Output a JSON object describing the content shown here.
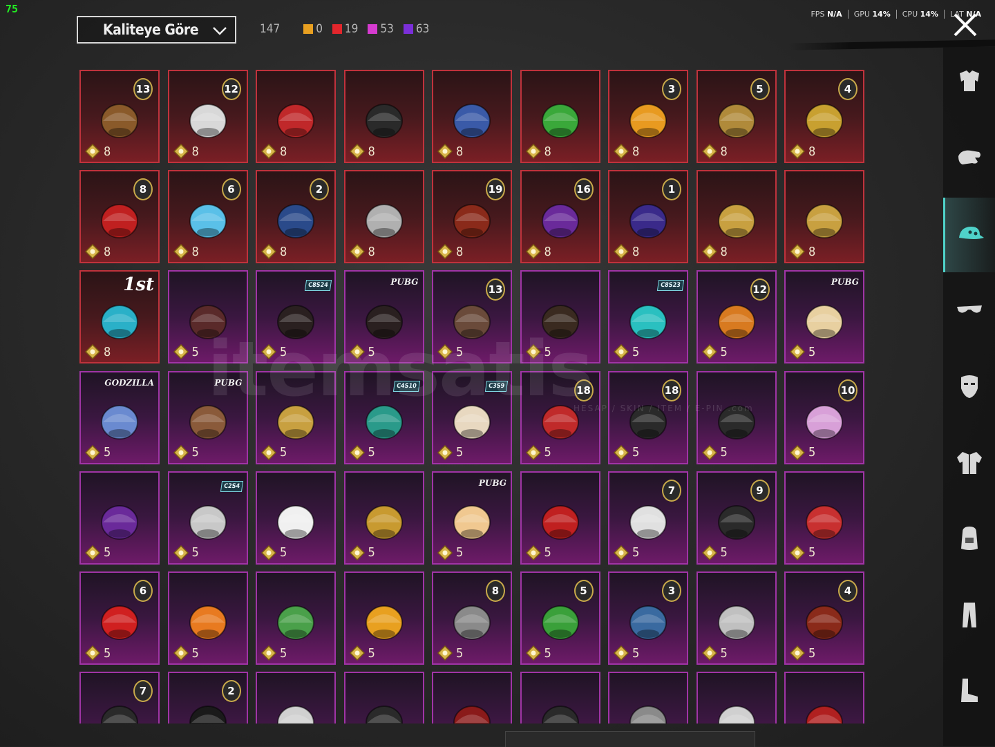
{
  "fps_counter": "75",
  "sort": {
    "label": "Kaliteye Göre"
  },
  "counts": {
    "total": "147",
    "items": [
      {
        "value": "0",
        "color": "#e8a021"
      },
      {
        "value": "19",
        "color": "#e3262c"
      },
      {
        "value": "53",
        "color": "#d63bd0"
      },
      {
        "value": "63",
        "color": "#7b2fd9"
      }
    ]
  },
  "stats": [
    {
      "label": "FPS",
      "value": "N/A"
    },
    {
      "label": "GPU",
      "value": "14%"
    },
    {
      "label": "CPU",
      "value": "14%"
    },
    {
      "label": "LAT",
      "value": "N/A"
    }
  ],
  "watermark": {
    "text": "itemsatis",
    "sub": "HESAP / SKIN / ITEM / E-PIN",
    "domain": ".com"
  },
  "colors": {
    "legendary_border": "#c0323c",
    "epic_border": "#a034a6",
    "accent": "#4fd2c9"
  },
  "sidebar": [
    {
      "name": "outfit-icon",
      "active": false
    },
    {
      "name": "glove-icon",
      "active": false
    },
    {
      "name": "cap-icon",
      "active": true
    },
    {
      "name": "glasses-icon",
      "active": false
    },
    {
      "name": "mask-icon",
      "active": false
    },
    {
      "name": "jacket-icon",
      "active": false
    },
    {
      "name": "backpack-icon",
      "active": false
    },
    {
      "name": "pants-icon",
      "active": false
    },
    {
      "name": "boots-icon",
      "active": false
    }
  ],
  "items": [
    {
      "q": "leg",
      "qty": "8",
      "badge": "13",
      "c": "#8a5a2a"
    },
    {
      "q": "leg",
      "qty": "8",
      "badge": "12",
      "c": "#d8d8d8"
    },
    {
      "q": "leg",
      "qty": "8",
      "badge": "",
      "c": "#c0282a"
    },
    {
      "q": "leg",
      "qty": "8",
      "badge": "",
      "c": "#2a2a2a"
    },
    {
      "q": "leg",
      "qty": "8",
      "badge": "",
      "c": "#3a5aa8"
    },
    {
      "q": "leg",
      "qty": "8",
      "badge": "",
      "c": "#3aa83a"
    },
    {
      "q": "leg",
      "qty": "8",
      "badge": "3",
      "c": "#e89a20"
    },
    {
      "q": "leg",
      "qty": "8",
      "badge": "5",
      "c": "#b08a3a"
    },
    {
      "q": "leg",
      "qty": "8",
      "badge": "4",
      "c": "#c8a030"
    },
    {
      "q": "leg",
      "qty": "8",
      "badge": "8",
      "c": "#c02020"
    },
    {
      "q": "leg",
      "qty": "8",
      "badge": "6",
      "c": "#5ac0e8"
    },
    {
      "q": "leg",
      "qty": "8",
      "badge": "2",
      "c": "#2a4a8a"
    },
    {
      "q": "leg",
      "qty": "8",
      "badge": "",
      "c": "#b0b0b0"
    },
    {
      "q": "leg",
      "qty": "8",
      "badge": "19",
      "c": "#8a2a1a"
    },
    {
      "q": "leg",
      "qty": "8",
      "badge": "16",
      "c": "#6a2a9a"
    },
    {
      "q": "leg",
      "qty": "8",
      "badge": "1",
      "c": "#3a2a8a"
    },
    {
      "q": "leg",
      "qty": "8",
      "badge": "",
      "c": "#c8a040"
    },
    {
      "q": "leg",
      "qty": "8",
      "badge": "",
      "c": "#c8a040"
    },
    {
      "q": "leg",
      "qty": "8",
      "tag": "1st",
      "c": "#2ab0c8"
    },
    {
      "q": "epic",
      "qty": "5",
      "badge": "",
      "c": "#5a2a2a"
    },
    {
      "q": "epic",
      "qty": "5",
      "season": "C8S24",
      "c": "#2a2020"
    },
    {
      "q": "epic",
      "qty": "5",
      "tag": "PUBG",
      "c": "#2a2020"
    },
    {
      "q": "epic",
      "qty": "5",
      "badge": "13",
      "c": "#6a4a3a"
    },
    {
      "q": "epic",
      "qty": "5",
      "badge": "",
      "c": "#3a2a20"
    },
    {
      "q": "epic",
      "qty": "5",
      "season": "C8S23",
      "c": "#2ac0c0"
    },
    {
      "q": "epic",
      "qty": "5",
      "badge": "12",
      "c": "#d87a20"
    },
    {
      "q": "epic",
      "qty": "5",
      "tag": "PUBG",
      "c": "#e8d0a0"
    },
    {
      "q": "epic",
      "qty": "5",
      "tag": "GODZILLA",
      "c": "#6a8ad0"
    },
    {
      "q": "epic",
      "qty": "5",
      "tag": "PUBG",
      "c": "#8a5a3a"
    },
    {
      "q": "epic",
      "qty": "5",
      "badge": "",
      "c": "#c8a040"
    },
    {
      "q": "epic",
      "qty": "5",
      "season": "C4S10",
      "c": "#2a9a8a"
    },
    {
      "q": "epic",
      "qty": "5",
      "season": "C3S9",
      "c": "#e8d8c0"
    },
    {
      "q": "epic",
      "qty": "5",
      "badge": "18",
      "c": "#c02a2a"
    },
    {
      "q": "epic",
      "qty": "5",
      "badge": "18",
      "c": "#2a2a2a"
    },
    {
      "q": "epic",
      "qty": "5",
      "badge": "",
      "c": "#2a2a2a"
    },
    {
      "q": "epic",
      "qty": "5",
      "badge": "10",
      "c": "#d8a0d8"
    },
    {
      "q": "epic",
      "qty": "5",
      "badge": "",
      "c": "#6a2a9a"
    },
    {
      "q": "epic",
      "qty": "5",
      "season": "C2S4",
      "c": "#c8c8c8"
    },
    {
      "q": "epic",
      "qty": "5",
      "badge": "",
      "c": "#f0f0f0"
    },
    {
      "q": "epic",
      "qty": "5",
      "badge": "",
      "c": "#c89a30"
    },
    {
      "q": "epic",
      "qty": "5",
      "tag": "PUBG",
      "c": "#f0c890"
    },
    {
      "q": "epic",
      "qty": "5",
      "badge": "",
      "c": "#c02020"
    },
    {
      "q": "epic",
      "qty": "5",
      "badge": "7",
      "c": "#e0e0e0"
    },
    {
      "q": "epic",
      "qty": "5",
      "badge": "9",
      "c": "#2a2a2a"
    },
    {
      "q": "epic",
      "qty": "5",
      "badge": "",
      "c": "#c83030"
    },
    {
      "q": "epic",
      "qty": "5",
      "badge": "6",
      "c": "#d02020"
    },
    {
      "q": "epic",
      "qty": "5",
      "badge": "",
      "c": "#e87a20"
    },
    {
      "q": "epic",
      "qty": "5",
      "badge": "",
      "c": "#4aa04a"
    },
    {
      "q": "epic",
      "qty": "5",
      "badge": "",
      "c": "#e8a020"
    },
    {
      "q": "epic",
      "qty": "5",
      "badge": "8",
      "c": "#8a8a8a"
    },
    {
      "q": "epic",
      "qty": "5",
      "badge": "5",
      "c": "#3aa03a"
    },
    {
      "q": "epic",
      "qty": "5",
      "badge": "3",
      "c": "#3a6aa0"
    },
    {
      "q": "epic",
      "qty": "5",
      "badge": "",
      "c": "#c0c0c0"
    },
    {
      "q": "epic",
      "qty": "5",
      "badge": "4",
      "c": "#8a2a1a"
    },
    {
      "q": "epic",
      "qty": "",
      "badge": "7",
      "c": "#2a2a2a"
    },
    {
      "q": "epic",
      "qty": "",
      "badge": "2",
      "c": "#1a1a1a"
    },
    {
      "q": "epic",
      "qty": "",
      "badge": "",
      "c": "#d0d0d0"
    },
    {
      "q": "epic",
      "qty": "",
      "badge": "",
      "c": "#2a2a2a"
    },
    {
      "q": "epic",
      "qty": "",
      "badge": "",
      "c": "#8a1a1a"
    },
    {
      "q": "epic",
      "qty": "",
      "badge": "",
      "c": "#2a2a2a"
    },
    {
      "q": "epic",
      "qty": "",
      "badge": "",
      "c": "#8a8a8a"
    },
    {
      "q": "epic",
      "qty": "",
      "badge": "",
      "c": "#d0d0d0"
    },
    {
      "q": "epic",
      "qty": "",
      "badge": "",
      "c": "#b02020"
    }
  ]
}
